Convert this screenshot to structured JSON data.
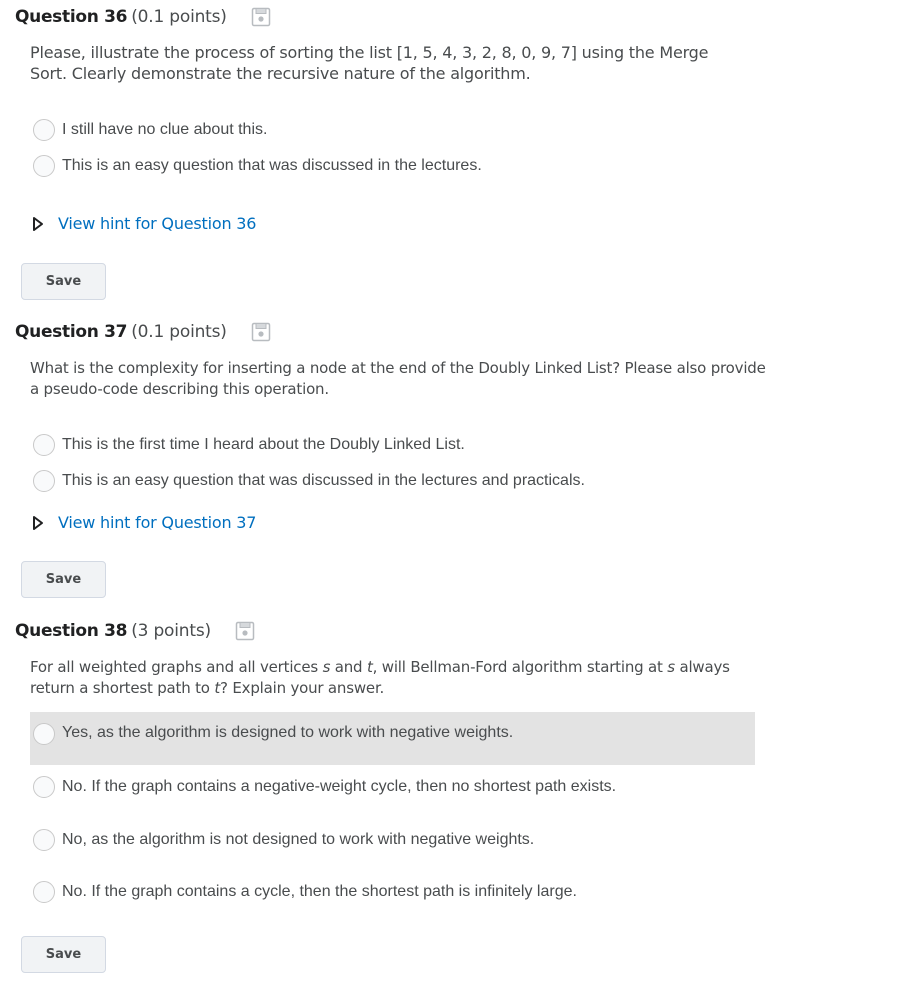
{
  "questions": [
    {
      "title": "Question 36",
      "points": "(0.1 points)",
      "text": "Please, illustrate the process of sorting the list [1, 5, 4, 3, 2, 8, 0, 9, 7] using the Merge Sort. Clearly demonstrate the recursive nature of the algorithm.",
      "options": [
        "I still have no clue about this.",
        "This is an easy question that was discussed in the lectures."
      ],
      "hint": "View hint for Question 36",
      "save_label": "Save"
    },
    {
      "title": "Question 37",
      "points": "(0.1 points)",
      "text": "What is the complexity for inserting a node at the end of the Doubly Linked List? Please also provide a pseudo-code describing this operation.",
      "options": [
        "This is the first time I heard about the Doubly Linked List.",
        "This is an easy question that was discussed in the lectures and practicals."
      ],
      "hint": "View hint for Question 37",
      "save_label": "Save"
    },
    {
      "title": "Question 38",
      "points": "(3 points)",
      "text_parts": [
        "For all weighted graphs and all vertices ",
        "s",
        " and ",
        "t",
        ", will Bellman-Ford algorithm starting at ",
        "s",
        " always return a shortest path to ",
        "t",
        "? Explain your answer."
      ],
      "options": [
        "Yes, as the algorithm is designed to work with negative weights.",
        "No. If the graph contains a negative-weight cycle, then no shortest path exists.",
        "No, as the algorithm is not designed to work with negative weights.",
        "No. If the graph contains a cycle, then the shortest path is infinitely large."
      ],
      "save_label": "Save"
    }
  ],
  "colors": {
    "link": "#006fbf",
    "text": "#494c4e",
    "heading": "#202122",
    "highlight_row": "#e3e3e3"
  },
  "icons": {
    "save_status": "floppy-disk-icon",
    "hint_toggle": "triangle-right-icon",
    "radio": "radio-button"
  }
}
